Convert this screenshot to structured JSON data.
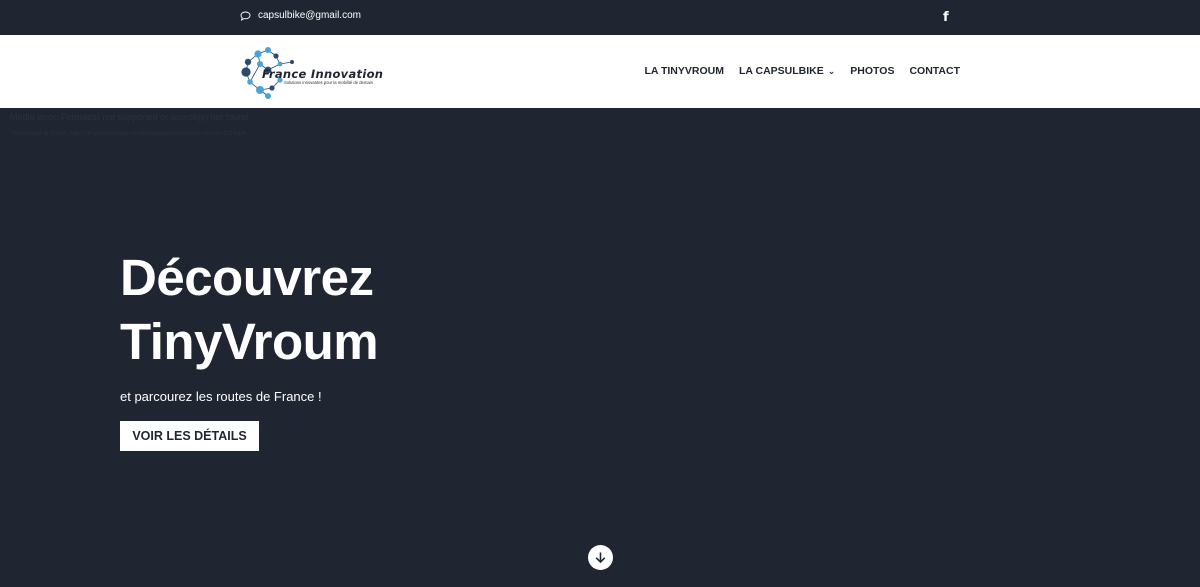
{
  "topbar": {
    "email": "capsulbike@gmail.com",
    "email_icon": "chat-bubble-icon",
    "facebook_icon": "facebook-icon",
    "facebook_glyph": "f"
  },
  "header": {
    "logo": {
      "brand": "France Innovation",
      "tagline": "Solutions innovantes pour la mobilité de demain"
    },
    "nav": [
      {
        "label": "LA TINYVROUM"
      },
      {
        "label": "LA CAPSULBIKE",
        "has_dropdown": true
      },
      {
        "label": "PHOTOS"
      },
      {
        "label": "CONTACT"
      }
    ]
  },
  "media": {
    "error": "Media error: Format(s) not supported or source(s) not found",
    "download": "Télécharger le fichier: https://tinyvroum.fr/wp-content/uploads/tinyvroum-version-1-3.mp4"
  },
  "hero": {
    "title_line1": "Découvrez",
    "title_line2": "TinyVroum",
    "subtitle": "et parcourez les routes de France !",
    "button": "VOIR LES DÉTAILS",
    "scroll_icon": "arrow-down-icon"
  },
  "colors": {
    "background": "#1f2531",
    "header_bg": "#ffffff",
    "text_light": "#ffffff",
    "text_dark": "#1f2531",
    "logo_blue_light": "#4aa3d8",
    "logo_blue_dark": "#2b4b6e"
  }
}
